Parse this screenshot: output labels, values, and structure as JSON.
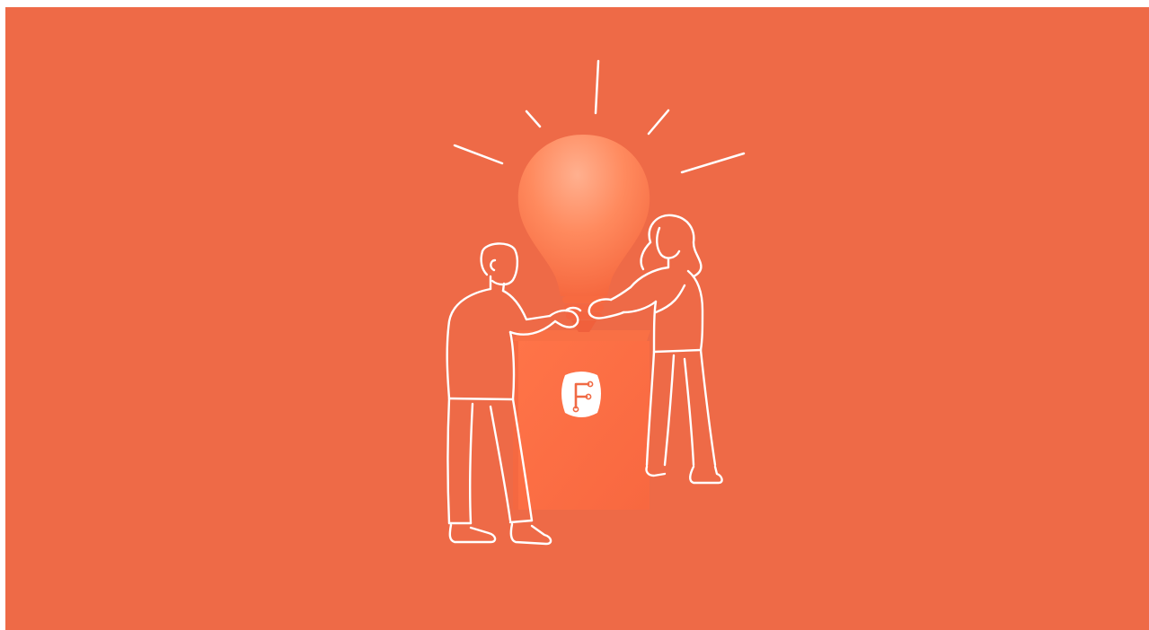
{
  "scene": {
    "description_icon": "lightbulb-teamwork-illustration",
    "colors": {
      "background": "#EE6A47",
      "bulb_light": "#FFAE8C",
      "bulb_mid": "#FF7A50",
      "bulb_dark": "#F45E36",
      "box_front": "#FF6F44",
      "box_side": "#F26843",
      "line_art": "#FFFFFF",
      "logo_mark": "#F06A45"
    },
    "logo": {
      "icon": "hexagon-logo-icon",
      "letter": "F"
    }
  }
}
